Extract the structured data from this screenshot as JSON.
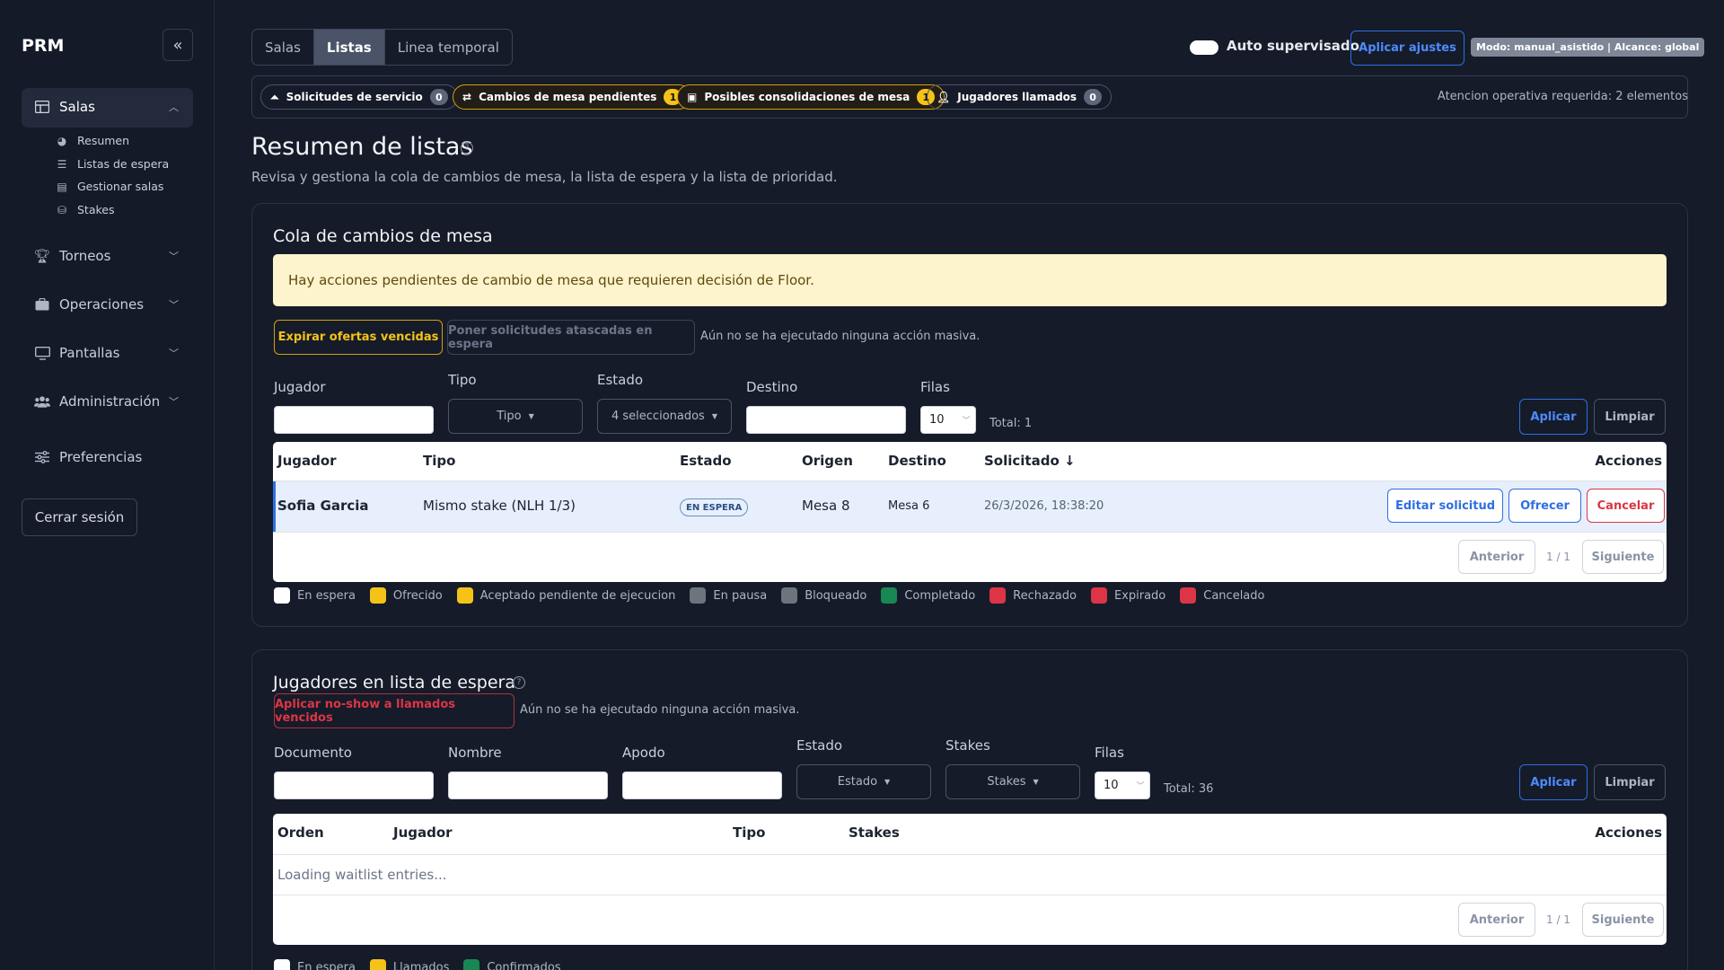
{
  "app": {
    "title": "PRM"
  },
  "sidebar": {
    "sections": [
      {
        "label": "Salas",
        "icon": "table-icon",
        "expanded": true
      },
      {
        "label": "Torneos",
        "icon": "trophy-icon",
        "expanded": false
      },
      {
        "label": "Operaciones",
        "icon": "briefcase-icon",
        "expanded": false
      },
      {
        "label": "Pantallas",
        "icon": "monitor-icon",
        "expanded": false
      },
      {
        "label": "Administración",
        "icon": "users-icon",
        "expanded": false
      },
      {
        "label": "Preferencias",
        "icon": "sliders-icon"
      }
    ],
    "salas_items": [
      {
        "label": "Resumen",
        "icon": "pie-chart-icon"
      },
      {
        "label": "Listas de espera",
        "icon": "list-icon"
      },
      {
        "label": "Gestionar salas",
        "icon": "clipboard-icon"
      },
      {
        "label": "Stakes",
        "icon": "coins-icon"
      }
    ],
    "logout": "Cerrar sesión"
  },
  "header": {
    "tabs": [
      "Salas",
      "Listas",
      "Linea temporal"
    ],
    "active_tab": "Listas",
    "auto_label": "Auto supervisado",
    "apply_settings": "Aplicar ajustes",
    "mode_badge": "Modo: manual_asistido | Alcance: global",
    "chips": [
      {
        "label": "Solicitudes de servicio",
        "count": "0"
      },
      {
        "label": "Cambios de mesa pendientes",
        "count": "1"
      },
      {
        "label": "Posibles consolidaciones de mesa",
        "count": "1"
      },
      {
        "label": "Jugadores llamados",
        "count": "0"
      }
    ],
    "attention": "Atencion operativa requerida: 2 elementos"
  },
  "page": {
    "title": "Resumen de listas",
    "subtitle": "Revisa y gestiona la cola de cambios de mesa, la lista de espera y la lista de prioridad."
  },
  "queue": {
    "title": "Cola de cambios de mesa",
    "notice": "Hay acciones pendientes de cambio de mesa que requieren decisión de Floor.",
    "expire_btn": "Expirar ofertas vencidas",
    "hold_btn": "Poner solicitudes atascadas en espera",
    "bulk_note": "Aún no se ha ejecutado ninguna acción masiva.",
    "filters": {
      "jugador": "Jugador",
      "tipo": "Tipo",
      "tipo_select": "Tipo",
      "estado": "Estado",
      "estado_select": "4 seleccionados",
      "destino": "Destino",
      "filas": "Filas",
      "filas_value": "10",
      "total": "Total: 1",
      "apply": "Aplicar",
      "clear": "Limpiar"
    },
    "columns": [
      "Jugador",
      "Tipo",
      "Estado",
      "Origen",
      "Destino",
      "Solicitado ↓",
      "Acciones"
    ],
    "rows": [
      {
        "jugador": "Sofia Garcia",
        "tipo": "Mismo stake (NLH 1/3)",
        "estado": "EN ESPERA",
        "origen": "Mesa 8",
        "destino": "Mesa 6",
        "solicitado": "26/3/2026, 18:38:20"
      }
    ],
    "actions": {
      "edit": "Editar solicitud",
      "offer": "Ofrecer",
      "cancel": "Cancelar"
    },
    "pager": {
      "prev": "Anterior",
      "page": "1 / 1",
      "next": "Siguiente"
    },
    "legend": [
      {
        "label": "En espera",
        "color": "#ffffff"
      },
      {
        "label": "Ofrecido",
        "color": "#f5c317"
      },
      {
        "label": "Aceptado pendiente de ejecucion",
        "color": "#f5c317"
      },
      {
        "label": "En pausa",
        "color": "#6c757d"
      },
      {
        "label": "Bloqueado",
        "color": "#6c757d"
      },
      {
        "label": "Completado",
        "color": "#198754"
      },
      {
        "label": "Rechazado",
        "color": "#dc3545"
      },
      {
        "label": "Expirado",
        "color": "#dc3545"
      },
      {
        "label": "Cancelado",
        "color": "#dc3545"
      }
    ]
  },
  "waitlist": {
    "title": "Jugadores en lista de espera",
    "noshow_btn": "Aplicar no-show a llamados vencidos",
    "bulk_note": "Aún no se ha ejecutado ninguna acción masiva.",
    "filters": {
      "documento": "Documento",
      "nombre": "Nombre",
      "apodo": "Apodo",
      "estado": "Estado",
      "estado_select": "Estado",
      "stakes": "Stakes",
      "stakes_select": "Stakes",
      "filas": "Filas",
      "filas_value": "10",
      "total": "Total: 36",
      "apply": "Aplicar",
      "clear": "Limpiar"
    },
    "columns": [
      "Orden",
      "Jugador",
      "Tipo",
      "Stakes",
      "Acciones"
    ],
    "loading": "Loading waitlist entries...",
    "pager": {
      "prev": "Anterior",
      "page": "1 / 1",
      "next": "Siguiente"
    },
    "legend": [
      {
        "label": "En espera",
        "color": "#ffffff"
      },
      {
        "label": "Llamados",
        "color": "#f5c317"
      },
      {
        "label": "Confirmados",
        "color": "#198754"
      }
    ]
  }
}
